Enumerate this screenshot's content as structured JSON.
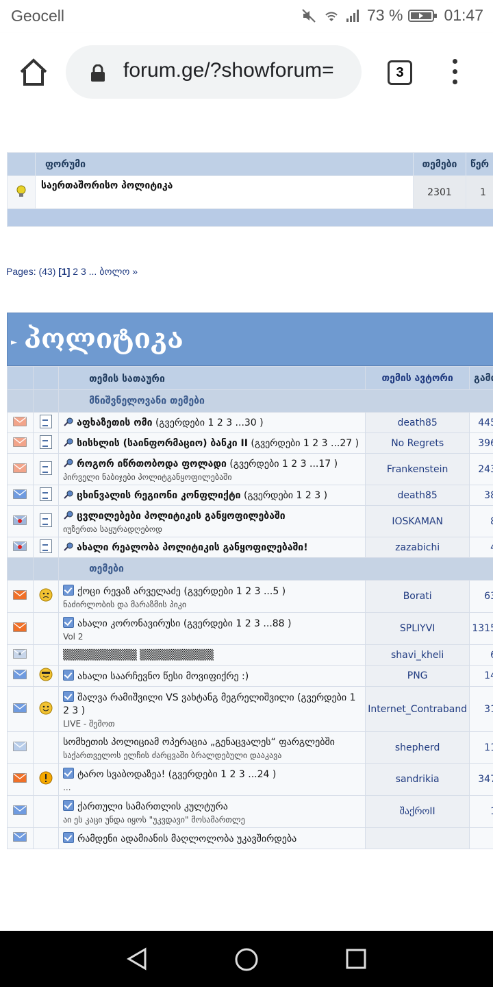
{
  "status": {
    "carrier": "Geocell",
    "battery": "73 %",
    "time": "01:47"
  },
  "browser": {
    "url": "forum.ge/?showforum=",
    "tab_count": "3"
  },
  "forum_table": {
    "headers": {
      "forum": "ფორუმი",
      "topics": "თემები",
      "replies": "წერ"
    },
    "row": {
      "name": "საერთაშორისო პოლიტიკა",
      "topics": "2301",
      "replies": "1"
    }
  },
  "pagination": {
    "prefix": "Pages: (43)",
    "current": "[1]",
    "p2": "2",
    "p3": "3",
    "last": "... ბოლო »"
  },
  "section_title": "პოლიტიკა",
  "columns": {
    "title": "თემის სათაური",
    "author": "თემის ავტორი",
    "replies": "გამო"
  },
  "pinned_label": "მნიშვნელოვანი თემები",
  "topics_label": "თემები",
  "pinned": [
    {
      "title": "აფხაზეთის ომი",
      "pages": "(გვერდები 1 2 3 ...30 )",
      "author": "death85",
      "count": "445",
      "env": "salmon"
    },
    {
      "title": "სისხლის (საინფორმაციო) ბანკი II",
      "pages": "(გვერდები 1 2 3 ...27 )",
      "author": "No Regrets",
      "count": "396",
      "env": "salmon"
    },
    {
      "title": "როგორ იწრთობოდა ფოლადი",
      "pages": "(გვერდები 1 2 3 ...17 )",
      "sub": "პირველი ნაბიჯები პოლიტგანყოფილებაში",
      "author": "Frankenstein",
      "count": "243",
      "env": "salmon"
    },
    {
      "title": "ცხინვალის რეგიონი კონფლიქტი",
      "pages": "(გვერდები 1 2 3 )",
      "author": "death85",
      "count": "38",
      "env": "blue"
    },
    {
      "title": "ცვლილებები პოლიტიკის განყოფილებაში",
      "sub": "იუზერთა საყურადღებოდ",
      "author": "IOSKAMAN",
      "count": "8",
      "env": "locked"
    },
    {
      "title": "ახალი რეალობა პოლიტიკის განყოფილებაში!",
      "author": "zazabichi",
      "count": "4",
      "env": "locked"
    }
  ],
  "topics": [
    {
      "title": "ქოცი რევაზ არველაძე",
      "pages": "(გვერდები 1 2 3 ...5 )",
      "sub": "ნაძირლობის და მარაზმის პიკი",
      "author": "Borati",
      "count": "63",
      "env": "orange",
      "face": "angry",
      "check": true
    },
    {
      "title": "ახალი კორონავირუსი",
      "pages": "(გვერდები 1 2 3 ...88 )",
      "sub": "Vol 2",
      "author": "SPLIYVI",
      "count": "1315",
      "env": "orange",
      "face": "",
      "check": true
    },
    {
      "title": "▒▒▒▒▒▒▒▒▒▒ ▒▒▒▒▒▒▒▒▒▒",
      "author": "shavi_kheli",
      "count": "6",
      "env": "moved",
      "face": "",
      "check": false
    },
    {
      "title": "ახალი საარჩევნო წესი მოვიფიქრე :)",
      "author": "PNG",
      "count": "14",
      "env": "blue",
      "face": "cool",
      "check": true
    },
    {
      "title": "შალვა რამიშვილი VS ვახტანგ მეგრელიშვილი",
      "pages": "(გვერდები 1 2 3 )",
      "sub": "LIVE - შემოთ",
      "author": "Internet_Contraband",
      "count": "31",
      "env": "blue",
      "face": "smile",
      "check": true
    },
    {
      "title": "სომხეთის პოლიციამ ოპერაცია „გენაცვალეს“ ფარგლებში",
      "sub": "საქართველოს ელჩის ძარცვაში ბრალდებული დააკავა",
      "author": "shepherd",
      "count": "11",
      "env": "lightblue",
      "face": "",
      "check": false
    },
    {
      "title": "ტარო სვაბოდაზეა!",
      "pages": "(გვერდები 1 2 3 ...24 )",
      "sub": "...",
      "author": "sandrikia",
      "count": "347",
      "env": "orange",
      "face": "warn",
      "check": true
    },
    {
      "title": "ქართული სამართლის კულტურა",
      "sub": "აი ეს კაცი უნდა იყოს \"უკვდავი\" მოსამართლე",
      "author": "შაქროII",
      "count": "1",
      "env": "blue",
      "face": "",
      "check": true
    },
    {
      "title": "რამდენი ადამიანის მაღლოლობა უკავშირდება",
      "author": "",
      "count": "",
      "env": "blue",
      "face": "",
      "check": true
    }
  ]
}
